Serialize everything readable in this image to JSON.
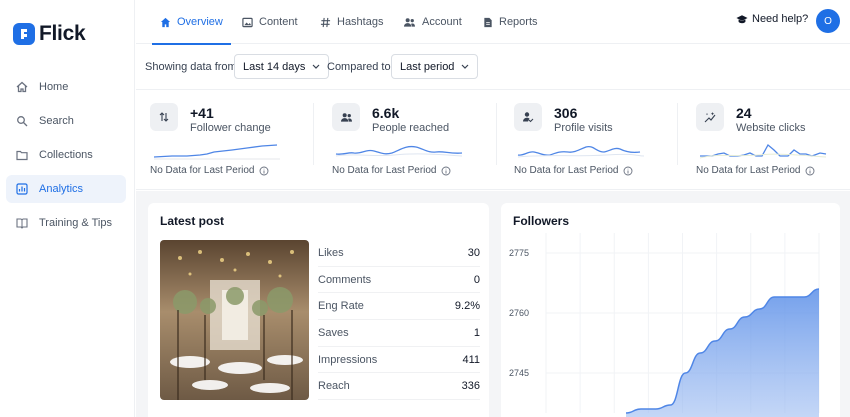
{
  "app": {
    "name": "Flick"
  },
  "sidebar": {
    "items": [
      {
        "label": "Home",
        "icon": "home-icon",
        "active": false
      },
      {
        "label": "Search",
        "icon": "search-icon",
        "active": false
      },
      {
        "label": "Collections",
        "icon": "folder-icon",
        "active": false
      },
      {
        "label": "Analytics",
        "icon": "analytics-icon",
        "active": true
      },
      {
        "label": "Training & Tips",
        "icon": "book-icon",
        "active": false
      }
    ]
  },
  "tabs": [
    {
      "label": "Overview",
      "icon": "home-icon",
      "active": true
    },
    {
      "label": "Content",
      "icon": "image-icon",
      "active": false
    },
    {
      "label": "Hashtags",
      "icon": "hashtag-icon",
      "active": false
    },
    {
      "label": "Account",
      "icon": "users-icon",
      "active": false
    },
    {
      "label": "Reports",
      "icon": "document-icon",
      "active": false
    }
  ],
  "header": {
    "help_label": "Need help?",
    "avatar_initial": "O"
  },
  "filters": {
    "showing_label": "Showing data from",
    "range_value": "Last 14 days",
    "compared_label": "Compared to",
    "compare_value": "Last period"
  },
  "stats": [
    {
      "value": "+41",
      "label": "Follower change",
      "note": "No Data for Last Period",
      "icon": "arrows-updown-icon"
    },
    {
      "value": "6.6k",
      "label": "People reached",
      "note": "No Data for Last Period",
      "icon": "people-icon"
    },
    {
      "value": "306",
      "label": "Profile visits",
      "note": "No Data for Last Period",
      "icon": "user-check-icon"
    },
    {
      "value": "24",
      "label": "Website clicks",
      "note": "No Data for Last Period",
      "icon": "sparkle-icon"
    }
  ],
  "latest_post": {
    "title": "Latest post",
    "metrics": [
      {
        "label": "Likes",
        "value": "30"
      },
      {
        "label": "Comments",
        "value": "0"
      },
      {
        "label": "Eng Rate",
        "value": "9.2%"
      },
      {
        "label": "Saves",
        "value": "1"
      },
      {
        "label": "Impressions",
        "value": "411"
      },
      {
        "label": "Reach",
        "value": "336"
      }
    ]
  },
  "followers": {
    "title": "Followers",
    "accent": "#4f86e6"
  },
  "chart_data": {
    "type": "area",
    "title": "Followers",
    "xlabel": "",
    "ylabel": "",
    "y_ticks": [
      2775,
      2760,
      2745
    ],
    "ylim": [
      2735,
      2780
    ],
    "values": [
      2735,
      2736,
      2736,
      2737,
      2745,
      2750,
      2753,
      2756,
      2759,
      2761,
      2764,
      2764,
      2764,
      2766
    ]
  }
}
